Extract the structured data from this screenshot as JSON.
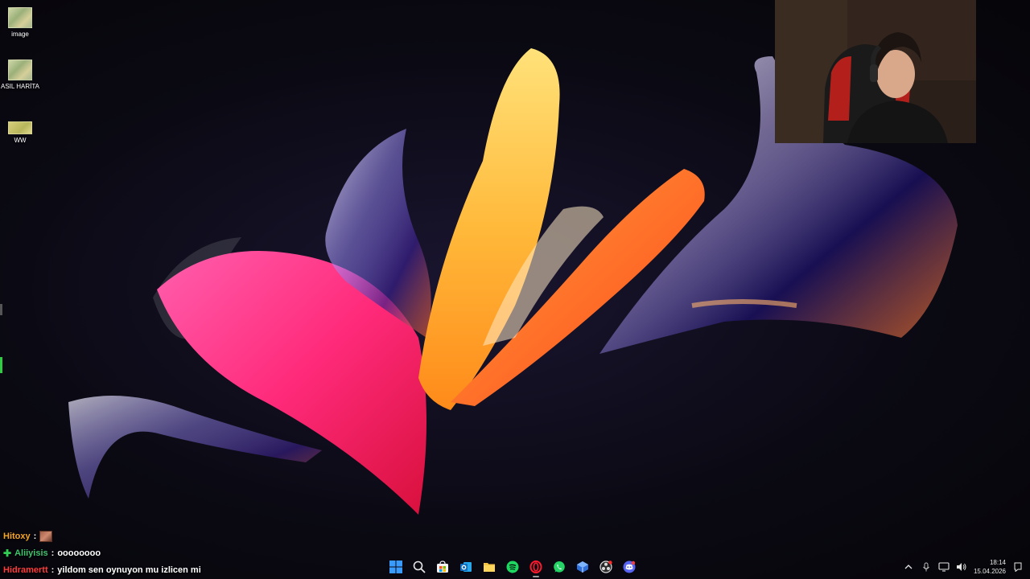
{
  "desktop": {
    "icons": [
      {
        "label": "image"
      },
      {
        "label": "ASIL HARİTA"
      },
      {
        "label": "WW"
      }
    ]
  },
  "chat": {
    "messages": [
      {
        "user": "Hitoxy",
        "user_color": "#f5a623",
        "separator": " :",
        "text": "",
        "has_emote": true,
        "has_badge": false
      },
      {
        "user": "Aliiyisis",
        "user_color": "#3ec46d",
        "separator": " :",
        "text": " oooooooo",
        "has_emote": false,
        "has_badge": true
      },
      {
        "user": "Hidramertt",
        "user_color": "#ff3b3b",
        "separator": " :",
        "text": " yildom sen oynuyon mu izlicen mi",
        "has_emote": false,
        "has_badge": false
      }
    ]
  },
  "taskbar": {
    "apps": [
      {
        "name": "start-button",
        "icon": "windows-icon"
      },
      {
        "name": "search-button",
        "icon": "search-icon"
      },
      {
        "name": "store-app",
        "icon": "store-icon"
      },
      {
        "name": "outlook-app",
        "icon": "outlook-icon"
      },
      {
        "name": "file-explorer-app",
        "icon": "folder-icon"
      },
      {
        "name": "spotify-app",
        "icon": "spotify-icon"
      },
      {
        "name": "opera-gx-app",
        "icon": "opera-icon"
      },
      {
        "name": "whatsapp-app",
        "icon": "whatsapp-icon"
      },
      {
        "name": "app-blue",
        "icon": "cube-icon"
      },
      {
        "name": "obs-app",
        "icon": "obs-icon"
      },
      {
        "name": "discord-app",
        "icon": "discord-icon"
      }
    ],
    "clock": {
      "time": "18:14",
      "date": "15.04.2026"
    }
  },
  "colors": {
    "accent_blue": "#3a9bff",
    "spotify_green": "#1ed760",
    "whatsapp_green": "#25d366",
    "discord_blurple": "#5865f2",
    "opera_red": "#ff1b2d"
  }
}
